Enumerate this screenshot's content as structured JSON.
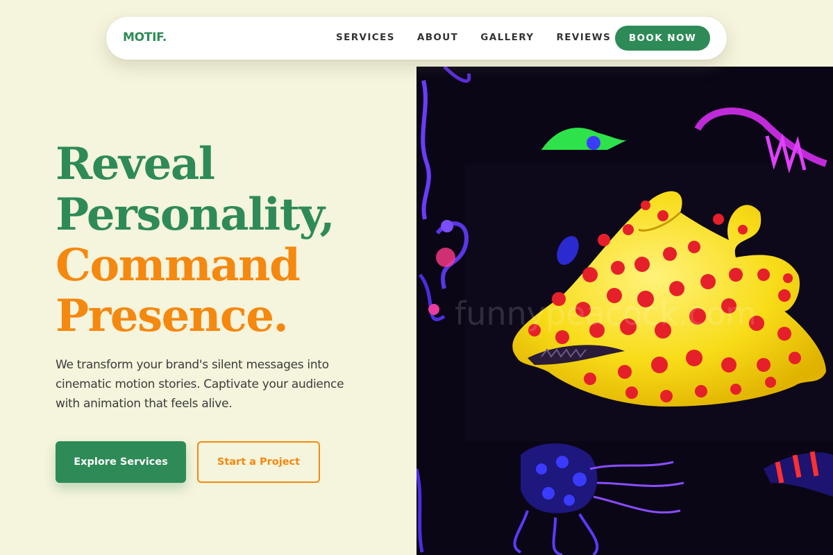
{
  "brand": {
    "logo": "MOTIF.",
    "green": "#2e8b57",
    "orange": "#f5880f",
    "background": "#f5f4dc"
  },
  "nav": {
    "links": [
      "SERVICES",
      "ABOUT",
      "GALLERY",
      "REVIEWS"
    ],
    "cta": "BOOK NOW"
  },
  "hero": {
    "headline": {
      "line1": "Reveal",
      "line2": "Personality,",
      "line3": "Command",
      "line4": "Presence."
    },
    "description": "We transform your brand's silent messages into cinematic motion stories. Captivate your audience with animation that feels alive.",
    "primary_button": "Explore Services",
    "secondary_button": "Start a Project",
    "image": {
      "subject": "yellow polka-dot creature sculpture under black light",
      "watermark": "funnypeacock.com"
    }
  }
}
